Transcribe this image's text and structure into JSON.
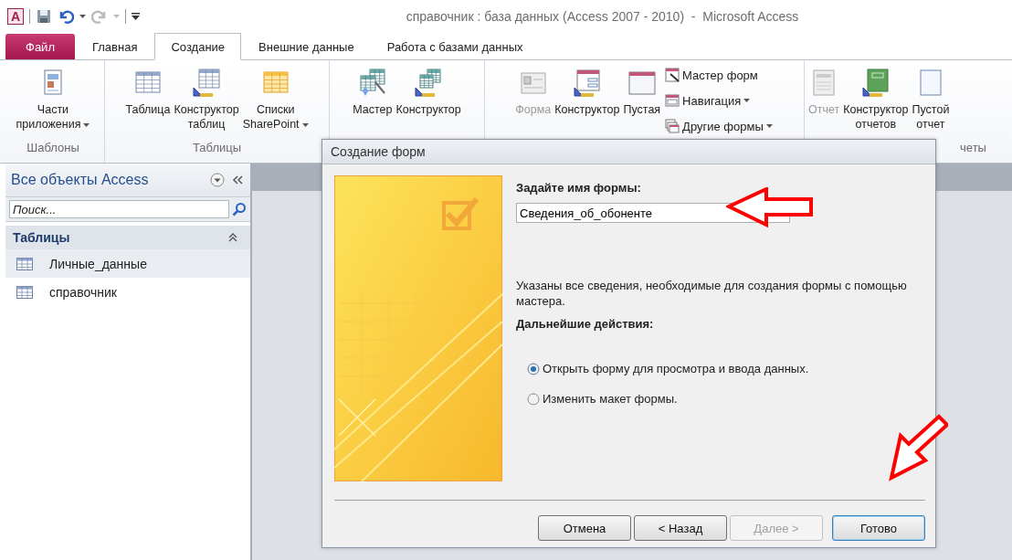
{
  "window": {
    "app_icon": "A",
    "title": "справочник : база данных (Access 2007 - 2010)  -  Microsoft Access"
  },
  "tabs": [
    {
      "label": "Файл",
      "kind": "file",
      "selected": false
    },
    {
      "label": "Главная",
      "kind": "tab",
      "selected": false
    },
    {
      "label": "Создание",
      "kind": "tab",
      "selected": true
    },
    {
      "label": "Внешние данные",
      "kind": "tab",
      "selected": false
    },
    {
      "label": "Работа с базами данных",
      "kind": "tab",
      "selected": false
    }
  ],
  "ribbon": {
    "groups": [
      {
        "label": "Шаблоны",
        "buttons": [
          {
            "label": "Части\nприложения",
            "kind": "large",
            "dropdown": true,
            "disabled": false
          }
        ]
      },
      {
        "label": "Таблицы",
        "buttons": [
          {
            "label": "Таблица",
            "kind": "large",
            "dropdown": false,
            "disabled": false
          },
          {
            "label": "Конструктор\nтаблиц",
            "kind": "large",
            "dropdown": false,
            "disabled": false
          },
          {
            "label": "Списки\nSharePoint",
            "kind": "large",
            "dropdown": true,
            "disabled": false
          }
        ]
      },
      {
        "buttons": [
          {
            "label": "Мастер",
            "kind": "large",
            "dropdown": false,
            "disabled": false
          },
          {
            "label": "Конструктор",
            "kind": "large",
            "dropdown": false,
            "disabled": false
          }
        ]
      },
      {
        "buttons": [
          {
            "label": "Форма",
            "kind": "large",
            "dropdown": false,
            "disabled": true
          },
          {
            "label": "Конструктор",
            "kind": "large",
            "dropdown": false,
            "disabled": false
          },
          {
            "label": "Пустая",
            "kind": "large",
            "dropdown": false,
            "disabled": false
          },
          {
            "label": "Мастер форм",
            "kind": "small",
            "dropdown": false,
            "disabled": false
          },
          {
            "label": "Навигация",
            "kind": "small",
            "dropdown": true,
            "disabled": false
          },
          {
            "label": "Другие формы",
            "kind": "small",
            "dropdown": true,
            "disabled": false
          }
        ]
      },
      {
        "label": "четы",
        "buttons": [
          {
            "label": "Отчет",
            "kind": "large",
            "dropdown": false,
            "disabled": true
          },
          {
            "label": "Конструктор\nотчетов",
            "kind": "large",
            "dropdown": false,
            "disabled": false
          },
          {
            "label": "Пустой\nотчет",
            "kind": "large",
            "dropdown": false,
            "disabled": false
          }
        ]
      }
    ]
  },
  "navigation": {
    "title": "Все объекты Access",
    "search": {
      "placeholder": "Поиск..."
    },
    "sections": [
      {
        "label": "Таблицы",
        "expanded": true,
        "items": [
          {
            "label": "Личные_данные",
            "selected": true
          },
          {
            "label": "справочник",
            "selected": false
          }
        ]
      }
    ]
  },
  "dialog": {
    "title": "Создание форм",
    "prompt": "Задайте имя формы:",
    "name_field": {
      "value": "Сведения_об_обоненте"
    },
    "info": "Указаны все сведения, необходимые для создания формы с помощью мастера.",
    "next_label": "Дальнейшие действия:",
    "options": [
      {
        "label": "Открыть форму для просмотра и ввода данных.",
        "selected": true
      },
      {
        "label": "Изменить макет формы.",
        "selected": false
      }
    ],
    "buttons": [
      {
        "label": "Отмена",
        "disabled": false,
        "default": false
      },
      {
        "label": "< Назад",
        "disabled": false,
        "default": false
      },
      {
        "label": "Далее >",
        "disabled": true,
        "default": false
      },
      {
        "label": "Готово",
        "disabled": false,
        "default": true
      }
    ]
  }
}
